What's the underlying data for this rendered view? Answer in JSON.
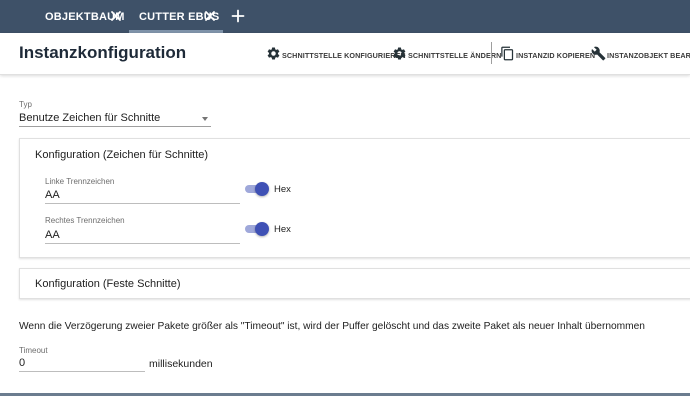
{
  "tabs": [
    {
      "label": "OBJEKTBAUM",
      "active": false
    },
    {
      "label": "CUTTER EBUS",
      "active": true
    }
  ],
  "header": {
    "title": "Instanzkonfiguration",
    "actions": [
      {
        "label": "SCHNITTSTELLE KONFIGURIEREN",
        "icon": "gear-icon"
      },
      {
        "label": "SCHNITTSTELLE ÄNDERN",
        "icon": "gear-icon"
      },
      {
        "label": "INSTANZID KOPIEREN",
        "icon": "copy-icon"
      },
      {
        "label": "INSTANZOBJEKT BEARBEITEN",
        "icon": "wrench-icon"
      }
    ]
  },
  "typ": {
    "label": "Typ",
    "value": "Benutze Zeichen für Schnitte"
  },
  "config_chars": {
    "title": "Konfiguration (Zeichen für Schnitte)",
    "left": {
      "label": "Linke Trennzeichen",
      "value": "AA",
      "hex_label": "Hex",
      "hex_on": true
    },
    "right": {
      "label": "Rechtes Trennzeichen",
      "value": "AA",
      "hex_label": "Hex",
      "hex_on": true
    }
  },
  "config_fixed": {
    "title": "Konfiguration (Feste Schnitte)"
  },
  "timeout_info": "Wenn die Verzögerung zweier Pakete größer als \"Timeout\" ist, wird der Puffer gelöscht und das zweite Paket als neuer Inhalt übernommen",
  "timeout": {
    "label": "Timeout",
    "value": "0",
    "unit": "millisekunden"
  },
  "colors": {
    "tabbar": "#3e5168",
    "switch_on": "#3f51b5",
    "switch_track": "#9fa8da"
  }
}
